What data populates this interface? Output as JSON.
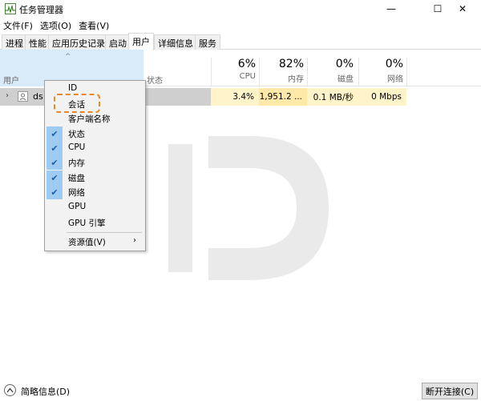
{
  "window": {
    "title": "任务管理器",
    "controls": {
      "minimize": "—",
      "maximize": "☐",
      "close": "✕"
    }
  },
  "menubar": [
    "文件(F)",
    "选项(O)",
    "查看(V)"
  ],
  "tabs": [
    {
      "label": "进程",
      "active": false
    },
    {
      "label": "性能",
      "active": false
    },
    {
      "label": "应用历史记录",
      "active": false
    },
    {
      "label": "启动",
      "active": false
    },
    {
      "label": "用户",
      "active": true
    },
    {
      "label": "详细信息",
      "active": false
    },
    {
      "label": "服务",
      "active": false
    }
  ],
  "header": {
    "sort_indicator": "^",
    "user_label": "用户",
    "status_label": "状态",
    "metrics": [
      {
        "pct": "6%",
        "label": "CPU"
      },
      {
        "pct": "82%",
        "label": "内存"
      },
      {
        "pct": "0%",
        "label": "磁盘"
      },
      {
        "pct": "0%",
        "label": "网络"
      }
    ]
  },
  "rows": [
    {
      "expander": "›",
      "name": "ds",
      "cpu": "3.4%",
      "memory": "1,951.2 ...",
      "disk": "0.1 MB/秒",
      "network": "0 Mbps"
    }
  ],
  "context_menu": {
    "items": [
      {
        "label": "ID",
        "checked": false
      },
      {
        "label": "会话",
        "checked": false,
        "highlighted": true
      },
      {
        "label": "客户端名称",
        "checked": false
      },
      {
        "label": "状态",
        "checked": true
      },
      {
        "label": "CPU",
        "checked": true
      },
      {
        "label": "内存",
        "checked": true
      },
      {
        "label": "磁盘",
        "checked": true
      },
      {
        "label": "网络",
        "checked": true
      },
      {
        "label": "GPU",
        "checked": false
      },
      {
        "label": "GPU 引擎",
        "checked": false
      }
    ],
    "submenu": {
      "label": "资源值(V)",
      "arrow": "›"
    },
    "check_glyph": "✔"
  },
  "footer": {
    "brief_label": "简略信息(D)",
    "brief_icon": "chevron-up-circle-icon",
    "disconnect_label": "断开连接(C)"
  },
  "colors": {
    "sort_column_bg": "#d9ebf9",
    "metric_cell_bg": "#fff3c9",
    "check_bg": "#9ecbf2",
    "highlight_border": "#e5892c"
  }
}
